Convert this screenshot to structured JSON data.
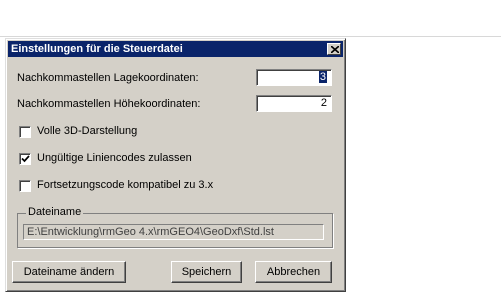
{
  "dialog": {
    "title": "Einstellungen für die Steuerdatei",
    "close_icon": "close-icon"
  },
  "fields": {
    "lage_label": "Nachkommastellen Lagekoordinaten:",
    "lage_value": "3",
    "hoehe_label": "Nachkommastellen Höhekoordinaten:",
    "hoehe_value": "2"
  },
  "options": [
    {
      "label": "Volle 3D-Darstellung",
      "checked": false
    },
    {
      "label": "Ungültige Liniencodes zulassen",
      "checked": true
    },
    {
      "label": "Fortsetzungscode kompatibel zu 3.x",
      "checked": false
    }
  ],
  "file": {
    "group_label": "Dateiname",
    "path": "E:\\Entwicklung\\rmGeo 4.x\\rmGEO4\\GeoDxf\\Std.lst"
  },
  "buttons": {
    "change_name": "Dateiname ändern",
    "save": "Speichern",
    "cancel": "Abbrechen"
  },
  "colors": {
    "titlebar": "#0a246a",
    "dialog_face": "#d4d0c8"
  }
}
